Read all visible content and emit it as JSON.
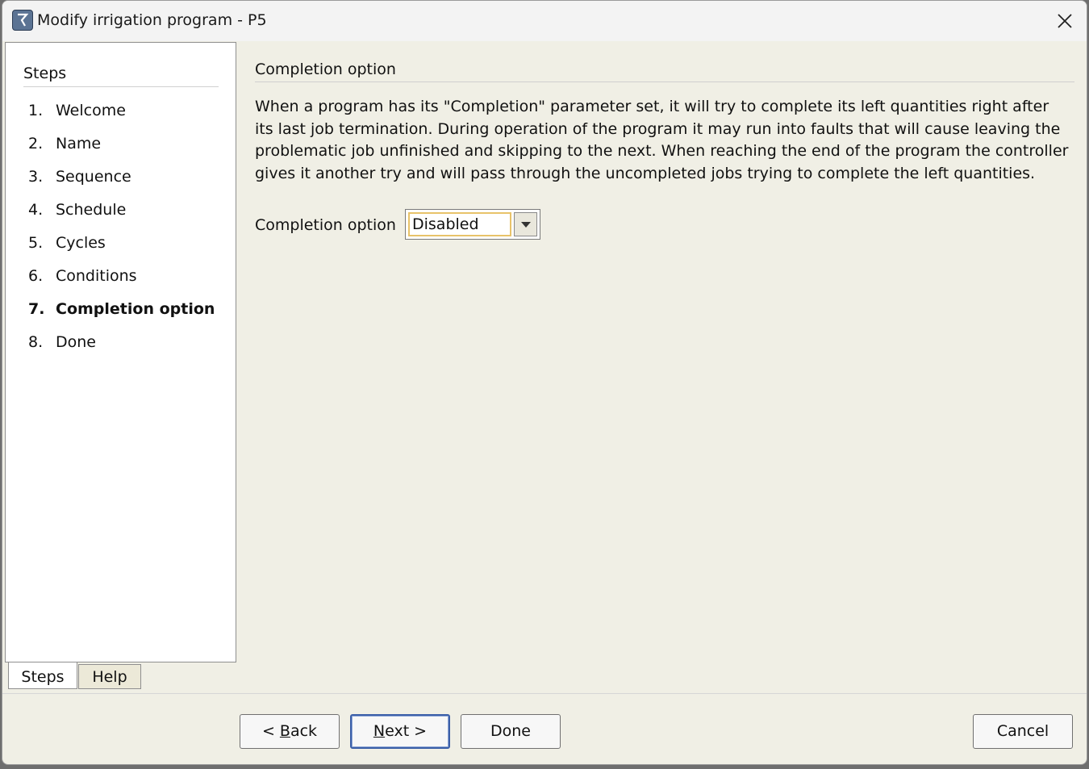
{
  "window": {
    "title": "Modify irrigation program - P5"
  },
  "sidebar": {
    "header": "Steps",
    "items": [
      {
        "num": "1.",
        "label": "Welcome"
      },
      {
        "num": "2.",
        "label": "Name"
      },
      {
        "num": "3.",
        "label": "Sequence"
      },
      {
        "num": "4.",
        "label": "Schedule"
      },
      {
        "num": "5.",
        "label": "Cycles"
      },
      {
        "num": "6.",
        "label": "Conditions"
      },
      {
        "num": "7.",
        "label": "Completion option",
        "active": true
      },
      {
        "num": "8.",
        "label": "Done"
      }
    ],
    "tabs": [
      "Steps",
      "Help"
    ]
  },
  "main": {
    "section_title": "Completion option",
    "description_lines": [
      "When a program has its \"Completion\" parameter set, it will try to complete its left quantities right after",
      "its last job termination. During operation of the program it may run into faults that will cause leaving the",
      "problematic job unfinished and skipping to the next. When reaching the end of the program the controller",
      "gives it another try and will pass through the uncompleted jobs trying to complete the left quantities."
    ],
    "option_label": "Completion option",
    "option_value": "Disabled"
  },
  "buttons": {
    "back_prefix": "< ",
    "back_mnemonic": "B",
    "back_rest": "ack",
    "next_mnemonic": "N",
    "next_rest": "ext >",
    "done": "Done",
    "cancel": "Cancel"
  },
  "colors": {
    "window_bg": "#f0efe5",
    "focus_highlight": "#e8c36a",
    "default_button_border": "#3b5fa8"
  }
}
